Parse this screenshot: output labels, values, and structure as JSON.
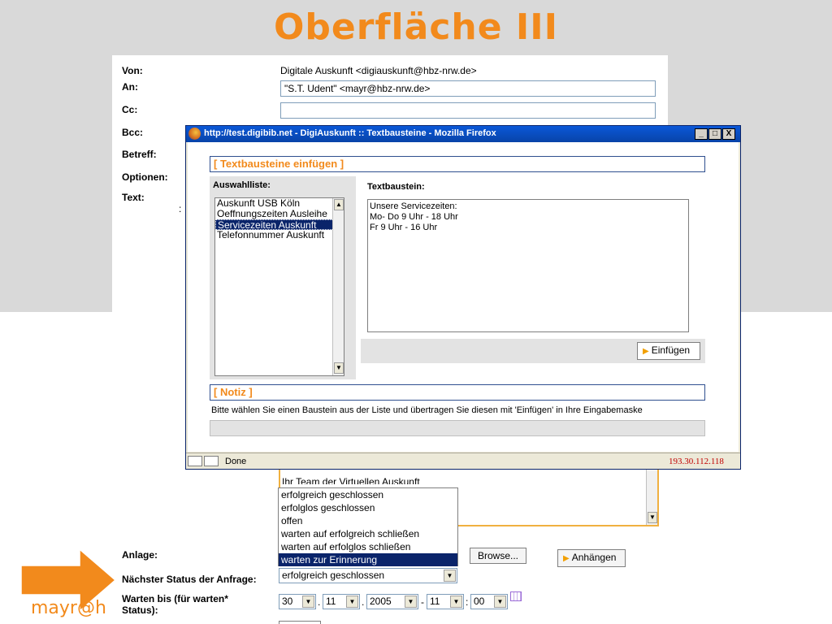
{
  "slide": {
    "title": "Oberfläche III",
    "corner_text": "mayr@h",
    "colors": {
      "title": "#f28a1c",
      "band": "#d9d9d9",
      "arrow": "#f28a1c"
    }
  },
  "mail_form": {
    "von_label": "Von:",
    "von_value": "Digitale Auskunft <digiauskunft@hbz-nrw.de>",
    "an_label": "An:",
    "an_value": "\"S.T. Udent\" <mayr@hbz-nrw.de>",
    "cc_label": "Cc:",
    "cc_value": "",
    "bcc_label": "Bcc:",
    "betreff_label": "Betreff:",
    "optionen_label": "Optionen:",
    "text_label": "Text:",
    "text_colon": ":"
  },
  "popup": {
    "title": "http://test.digibib.net - DigiAuskunft :: Textbausteine - Mozilla Firefox",
    "section_header": "[ Textbausteine einfügen ]",
    "auswahlliste_label": "Auswahlliste:",
    "list_items": [
      "Auskunft USB Köln",
      "Oeffnungszeiten Ausleihe",
      "Servicezeiten Auskunft",
      "Telefonnummer Auskunft"
    ],
    "selected_index": 2,
    "textbaustein_label": "Textbaustein:",
    "textbaustein_lines": [
      "Unsere Servicezeiten:",
      "Mo- Do 9 Uhr - 18 Uhr",
      "Fr 9 Uhr - 16 Uhr"
    ],
    "einfuegen_button": "Einfügen",
    "notiz_header": "[ Notiz ]",
    "notiz_text": "Bitte wählen Sie einen Baustein aus der Liste und übertragen Sie diesen mit 'Einfügen' in Ihre Eingabemaske",
    "status_text": "Done",
    "ip_address": "193.30.112.118",
    "win_buttons": [
      "_",
      "□",
      "X"
    ]
  },
  "lower_form": {
    "text_peek": "Ihr Team der Virtuellen Auskunft",
    "status_options": [
      "erfolgreich geschlossen",
      "erfolglos geschlossen",
      "offen",
      "warten auf erfolgreich schließen",
      "warten auf erfolglos schließen",
      "warten zur Erinnerung"
    ],
    "status_selected_index": 5,
    "anlage_label": "Anlage:",
    "browse_button": "Browse...",
    "anhaengen_button": "Anhängen",
    "naechster_status_label": "Nächster Status der Anfrage:",
    "status_current_value": "erfolgreich geschlossen",
    "warten_bis_label_1": "Warten bis (für warten*",
    "warten_bis_label_2": "Status):",
    "date": {
      "day": "30",
      "month": "11",
      "year": "2005",
      "hour": "11",
      "minute": "00",
      "sep1": ".",
      "sep2": ".",
      "sep3": "-",
      "sep4": ":"
    }
  }
}
